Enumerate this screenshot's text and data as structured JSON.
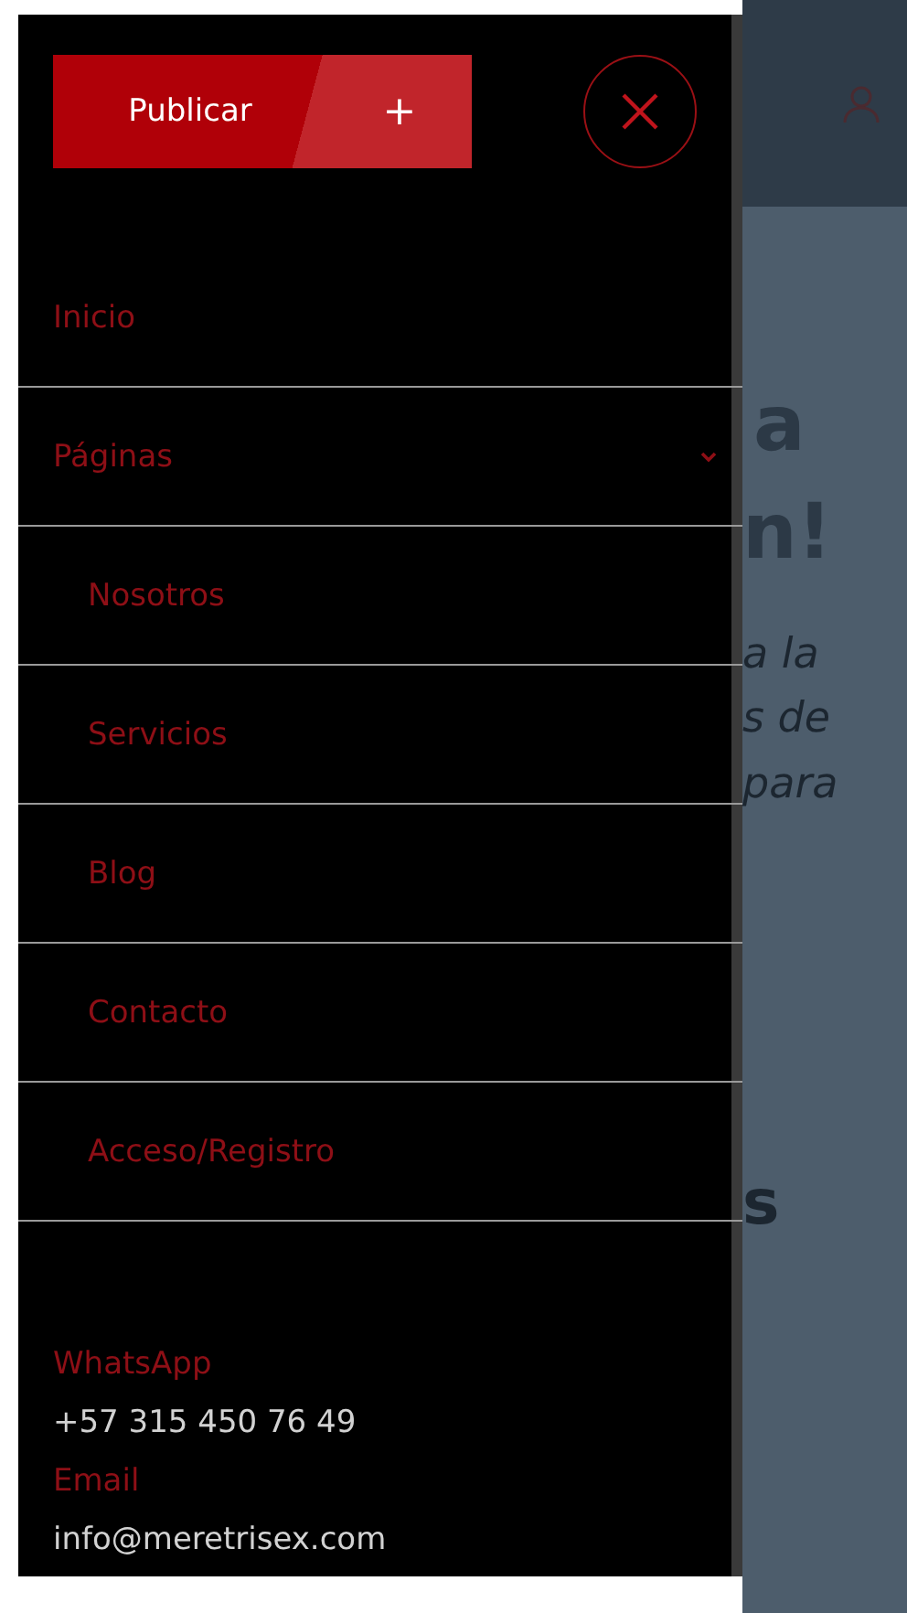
{
  "drawer": {
    "publish_button": {
      "label": "Publicar",
      "plus": "+"
    },
    "menu": [
      {
        "label": "Inicio"
      },
      {
        "label": "Páginas",
        "expanded": true,
        "children": [
          {
            "label": "Nosotros"
          },
          {
            "label": "Servicios"
          },
          {
            "label": "Blog"
          },
          {
            "label": "Contacto"
          },
          {
            "label": "Acceso/Registro"
          }
        ]
      }
    ],
    "contacts": [
      {
        "label": "WhatsApp",
        "value": "+57 315 450 76 49"
      },
      {
        "label": "Email",
        "value": "info@meretrisex.com"
      }
    ]
  },
  "background": {
    "heading": [
      "a",
      "n!"
    ],
    "subtitle": [
      "a la",
      "s de",
      "para"
    ],
    "section": "s"
  }
}
